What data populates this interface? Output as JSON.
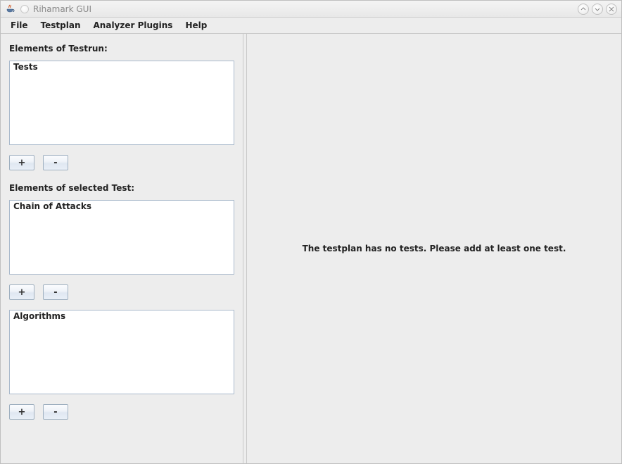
{
  "window": {
    "title": "Rihamark GUI"
  },
  "menubar": {
    "file": "File",
    "testplan": "Testplan",
    "analyzer": "Analyzer Plugins",
    "help": "Help"
  },
  "left": {
    "testrun_label": "Elements of Testrun:",
    "tests_box_title": "Tests",
    "tests_add": "+",
    "tests_remove": "-",
    "selected_label": "Elements of selected Test:",
    "chain_box_title": "Chain of Attacks",
    "chain_add": "+",
    "chain_remove": "-",
    "algos_box_title": "Algorithms",
    "algos_add": "+",
    "algos_remove": "-"
  },
  "right": {
    "message": "The testplan has no tests. Please add at least one test."
  }
}
